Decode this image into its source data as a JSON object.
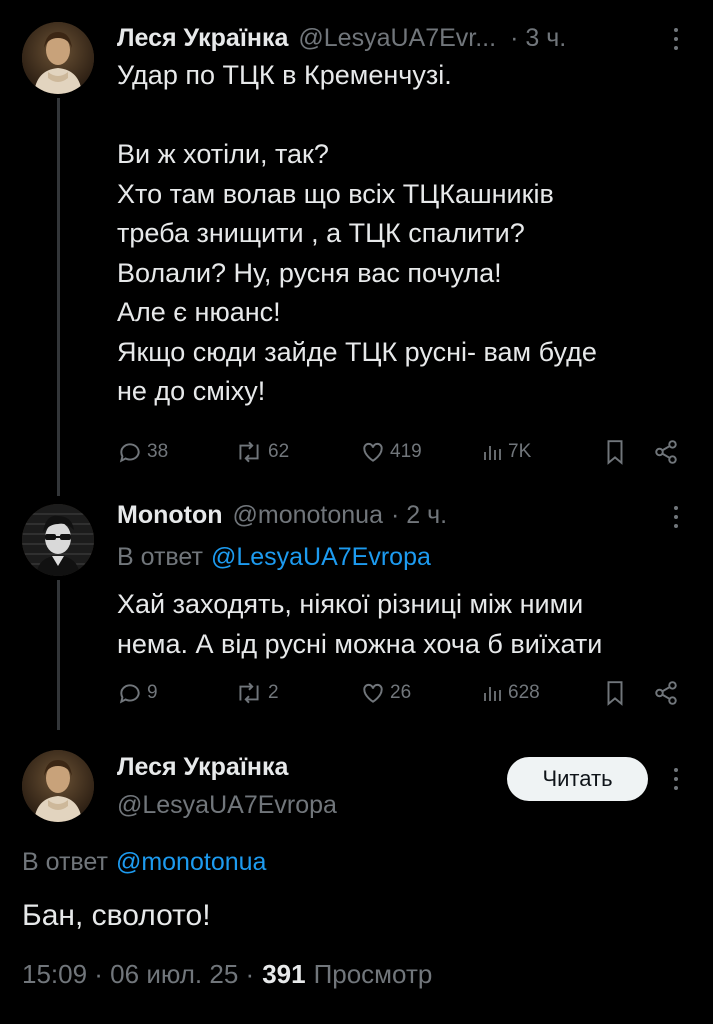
{
  "tweet1": {
    "author_name": "Леся Українка",
    "handle": "@LesyaUA7Evr...",
    "time": "· 3 ч.",
    "text": "Удар по ТЦК в Кременчузі.\n\nВи ж хотіли, так?\nХто там волав що всіх ТЦКашників\nтреба знищити , а ТЦК спалити?\nВолали? Ну, русня вас почула!\nАле є нюанс!\nЯкщо сюди зайде ТЦК русні- вам буде\nне до сміху!",
    "replies": "38",
    "reposts": "62",
    "likes": "419",
    "views": "7K"
  },
  "tweet2": {
    "author_name": "Monoton",
    "handle": "@monotonua",
    "time": "· 2 ч.",
    "reply_prefix": "В ответ",
    "reply_to": "@LesyaUA7Evropa",
    "text": "Хай заходять, ніякої різниці між ними\nнема. А від русні можна хоча б виїхати",
    "replies": "9",
    "reposts": "2",
    "likes": "26",
    "views": "628"
  },
  "tweet3": {
    "author_name": "Леся Українка",
    "handle": "@LesyaUA7Evropa",
    "follow_label": "Читать",
    "reply_prefix": "В ответ",
    "reply_to": "@monotonua",
    "text": "Бан, сволото!",
    "timestamp": "15:09 · 06 июл. 25 ·",
    "views_count": "391",
    "views_label": "Просмотр"
  },
  "colors": {
    "background": "#000000",
    "text": "#e7e9ea",
    "muted": "#71767b",
    "link": "#1d9bf0",
    "button_bg": "#eff3f4"
  }
}
